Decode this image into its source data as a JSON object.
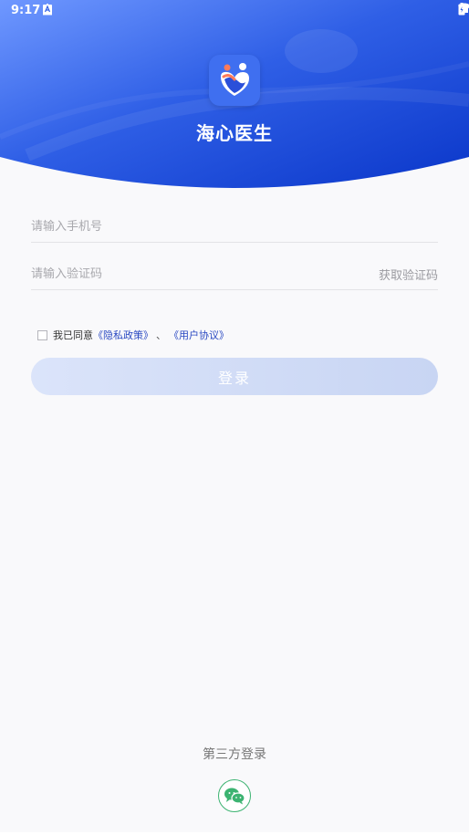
{
  "status_bar": {
    "time": "9:17"
  },
  "app": {
    "name": "海心医生"
  },
  "form": {
    "phone_placeholder": "请输入手机号",
    "code_placeholder": "请输入验证码",
    "get_code_label": "获取验证码",
    "agree_prefix": "我已同意",
    "privacy_link": "《隐私政策》",
    "separator": "、",
    "terms_link": "《用户协议》",
    "login_label": "登录"
  },
  "third_party": {
    "title": "第三方登录"
  },
  "icons": {
    "wechat": "wechat-icon",
    "download": "download-icon",
    "wifi": "wifi-icon",
    "signal": "signal-icon",
    "battery": "battery-icon"
  },
  "colors": {
    "brand_blue": "#1f4fe0",
    "link_blue": "#2a49c2",
    "wechat_green": "#3cb371"
  }
}
